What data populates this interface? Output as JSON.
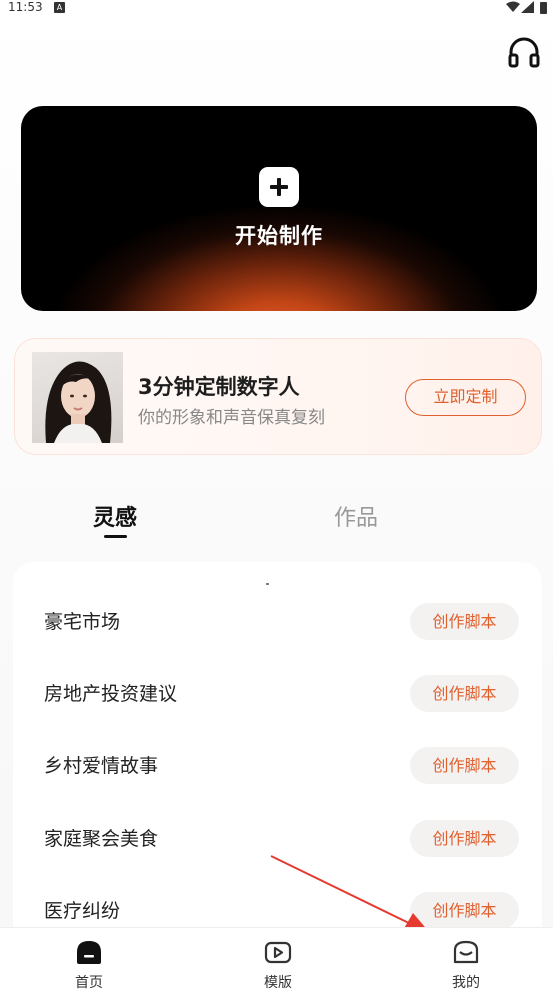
{
  "status_bar": {
    "time": "11:53",
    "notification_glyph": "A"
  },
  "hero": {
    "title": "开始制作",
    "icon": "plus-icon"
  },
  "custom_card": {
    "title": "3分钟定制数字人",
    "subtitle": "你的形象和声音保真复刻",
    "button": "立即定制"
  },
  "tabs": [
    {
      "label": "灵感",
      "active": true
    },
    {
      "label": "作品",
      "active": false
    }
  ],
  "list": {
    "items": [
      {
        "label": "豪宅市场",
        "button": "创作脚本"
      },
      {
        "label": "房地产投资建议",
        "button": "创作脚本"
      },
      {
        "label": "乡村爱情故事",
        "button": "创作脚本"
      },
      {
        "label": "家庭聚会美食",
        "button": "创作脚本"
      },
      {
        "label": "医疗纠纷",
        "button": "创作脚本"
      }
    ]
  },
  "bottom_nav": [
    {
      "label": "首页",
      "icon": "home-icon",
      "active": true
    },
    {
      "label": "模版",
      "icon": "video-template-icon",
      "active": false
    },
    {
      "label": "我的",
      "icon": "mailbox-icon",
      "active": false
    }
  ],
  "colors": {
    "accent": "#e0602e",
    "text": "#222222",
    "muted": "#888888"
  }
}
